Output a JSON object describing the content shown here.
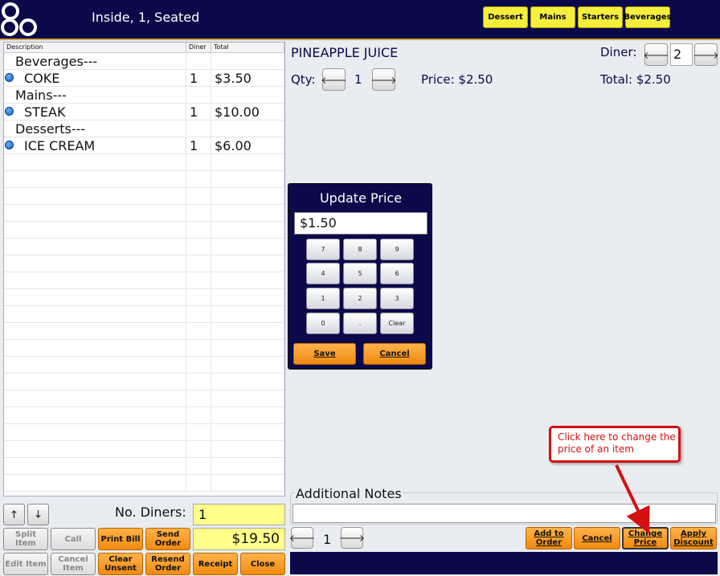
{
  "header": {
    "title": "Inside, 1, Seated",
    "categories": [
      "Dessert",
      "Mains",
      "Starters",
      "Beverages"
    ]
  },
  "order_list": {
    "columns": [
      "Description",
      "Diner",
      "Total"
    ],
    "rows": [
      {
        "type": "group",
        "desc": "Beverages---",
        "diner": "",
        "total": ""
      },
      {
        "type": "item",
        "desc": "COKE",
        "diner": "1",
        "total": "$3.50"
      },
      {
        "type": "group",
        "desc": "Mains---",
        "diner": "",
        "total": ""
      },
      {
        "type": "item",
        "desc": "STEAK",
        "diner": "1",
        "total": "$10.00"
      },
      {
        "type": "group",
        "desc": "Desserts---",
        "diner": "",
        "total": ""
      },
      {
        "type": "item",
        "desc": "ICE CREAM",
        "diner": "1",
        "total": "$6.00"
      }
    ]
  },
  "left_controls": {
    "up_arrow": "🡑",
    "down_arrow": "🡓",
    "no_diners_label": "No. Diners:",
    "no_diners_value": "1",
    "total": "$19.50",
    "split_item": "Split Item",
    "call": "Call",
    "print_bill": "Print  Bill",
    "send_order": "Send Order",
    "edit_item": "Edit Item",
    "cancel_item": "Cancel Item",
    "clear_unsent": "Clear Unsent",
    "resend_order": "Resend Order",
    "receipt": "Receipt",
    "close": "Close"
  },
  "item_panel": {
    "name": "PINEAPPLE JUICE",
    "qty_label": "Qty:",
    "qty_value": "1",
    "price_label": "Price: $2.50",
    "diner_label": "Diner:",
    "diner_value": "2",
    "total_label": "Total: $2.50",
    "left_arrow": "🡐",
    "right_arrow": "🡒"
  },
  "update_price_dialog": {
    "title": "Update Price",
    "value": "$1.50",
    "keys": [
      "7",
      "8",
      "9",
      "4",
      "5",
      "6",
      "1",
      "2",
      "3",
      "0",
      ".",
      "Clear"
    ],
    "save": "Save",
    "cancel": "Cancel"
  },
  "callout": {
    "text": "Click here to change the price of an item",
    "color": "#d41010"
  },
  "notes": {
    "label": "Additional Notes",
    "value": ""
  },
  "bottom_controls": {
    "page_number": "1",
    "add_to_order": "Add to Order",
    "cancel": "Cancel",
    "change_price": "Change Price",
    "apply_discount": "Apply Discount"
  },
  "colors": {
    "header_bg": "#0a0a4a",
    "category_button": "#f5ee3c",
    "orange_button": "#f5a025",
    "highlight_field": "#ffff8a"
  }
}
